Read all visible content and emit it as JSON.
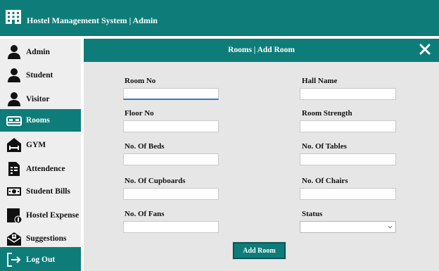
{
  "header": {
    "title": "Hostel Management System | Admin",
    "logo_icon": "building-icon"
  },
  "sidebar": {
    "items": [
      {
        "label": "Admin",
        "icon": "person-icon"
      },
      {
        "label": "Student",
        "icon": "person-icon"
      },
      {
        "label": "Visitor",
        "icon": "person-icon"
      },
      {
        "label": "Rooms",
        "icon": "bed-icon",
        "active": true
      },
      {
        "label": "GYM",
        "icon": "dumbbell-icon"
      },
      {
        "label": "Attendence",
        "icon": "document-icon"
      },
      {
        "label": "Student Bills",
        "icon": "money-icon"
      },
      {
        "label": "Hostel Expense",
        "icon": "expense-icon"
      },
      {
        "label": "Suggestions",
        "icon": "envelope-icon"
      },
      {
        "label": "Log Out",
        "icon": "logout-icon"
      }
    ]
  },
  "panel": {
    "title": "Rooms | Add Room",
    "close_icon": "close-icon",
    "fields": {
      "room_no": {
        "label": "Room No",
        "value": ""
      },
      "hall_name": {
        "label": "Hall Name",
        "value": ""
      },
      "floor_no": {
        "label": "Floor No",
        "value": ""
      },
      "room_strength": {
        "label": "Room Strength",
        "value": ""
      },
      "beds": {
        "label": "No. Of Beds",
        "value": ""
      },
      "tables": {
        "label": "No. Of Tables",
        "value": ""
      },
      "cupboards": {
        "label": "No. Of Cupboards",
        "value": ""
      },
      "chairs": {
        "label": "No. Of Chairs",
        "value": ""
      },
      "fans": {
        "label": "No. Of Fans",
        "value": ""
      },
      "status": {
        "label": "Status",
        "value": ""
      }
    },
    "submit_label": "Add Room"
  },
  "colors": {
    "accent": "#0e7d7a",
    "panel_bg": "#e6e6e6",
    "sidebar_bg": "#eeeeee"
  }
}
